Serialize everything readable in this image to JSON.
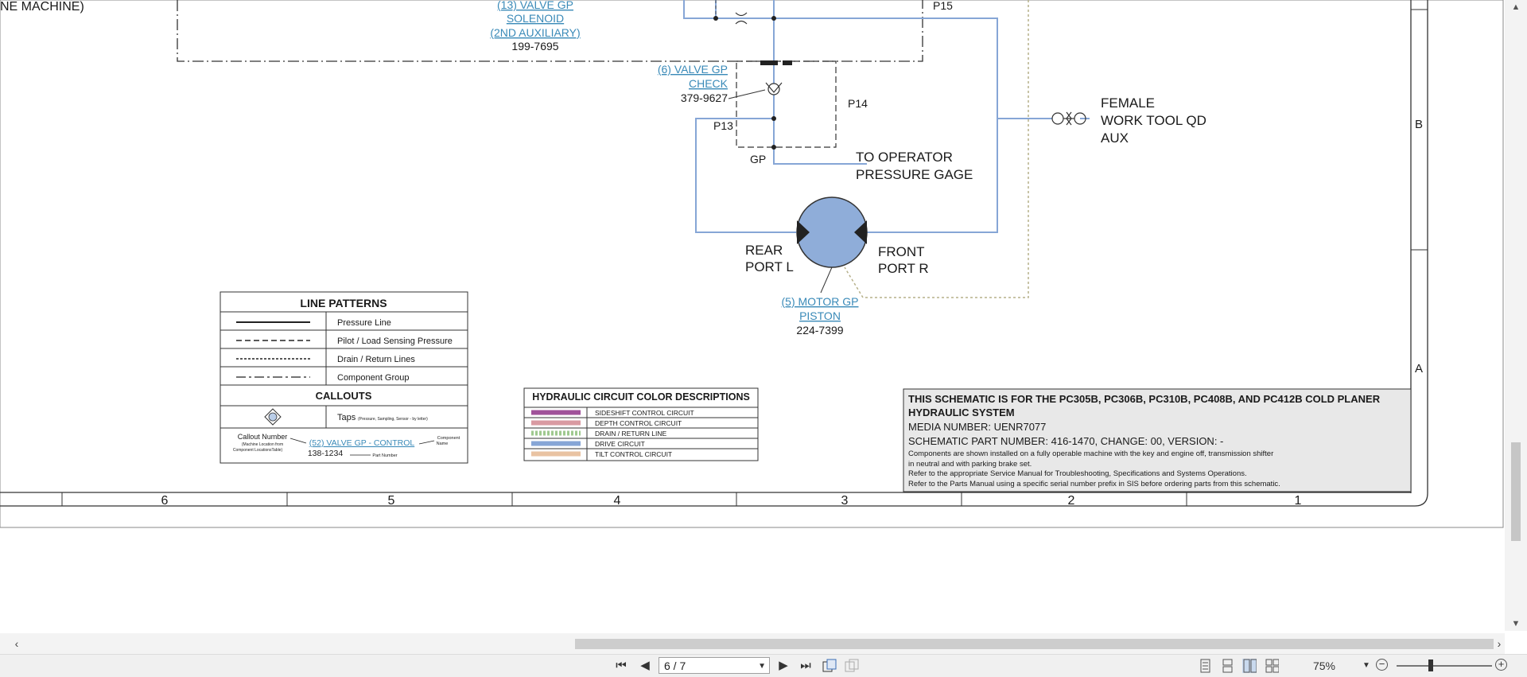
{
  "diagram": {
    "top_left_fragment": "NE MACHINE)",
    "valve13": {
      "line1": "(13) VALVE GP",
      "line2": "SOLENOID",
      "line3": "(2ND AUXILIARY)",
      "part": "199-7695"
    },
    "valve6": {
      "line1": "(6) VALVE GP",
      "line2": "CHECK",
      "part": "379-9627"
    },
    "motor5": {
      "line1": "(5) MOTOR GP",
      "line2": "PISTON",
      "part": "224-7399"
    },
    "labels": {
      "p15": "P15",
      "p14": "P14",
      "p13": "P13",
      "gp": "GP",
      "to_operator_1": "TO OPERATOR",
      "to_operator_2": "PRESSURE GAGE",
      "female_1": "FEMALE",
      "female_2": "WORK TOOL QD",
      "female_3": "AUX",
      "rear_1": "REAR",
      "rear_2": "PORT L",
      "front_1": "FRONT",
      "front_2": "PORT R"
    },
    "zones": {
      "b": "B",
      "a": "A"
    },
    "columns": [
      "6",
      "5",
      "4",
      "3",
      "2",
      "1"
    ],
    "line_patterns": {
      "title": "LINE PATTERNS",
      "rows": [
        "Pressure Line",
        "Pilot / Load Sensing Pressure",
        "Drain / Return Lines",
        "Component Group"
      ],
      "callouts_title": "CALLOUTS",
      "taps_label": "Taps",
      "taps_sub": "(Pressure, Sampling, Sensor - by letter)",
      "callout_number": "Callout Number",
      "callout_sub_1": "(Machine Location from",
      "callout_sub_2": "Component LocationsTable)",
      "callout_example": "(52) VALVE GP - CONTROL",
      "component_1": "Component",
      "component_2": "Name",
      "callout_part": "138-1234",
      "part_number": "Part Number"
    },
    "color_desc": {
      "title": "HYDRAULIC CIRCUIT COLOR DESCRIPTIONS",
      "rows": [
        {
          "label": "SIDESHIFT CONTROL CIRCUIT",
          "color": "#a0529a",
          "style": "solid"
        },
        {
          "label": "DEPTH CONTROL CIRCUIT",
          "color": "#d99aa2",
          "style": "solid"
        },
        {
          "label": "DRAIN / RETURN LINE",
          "color": "#9fc98f",
          "style": "dotted"
        },
        {
          "label": "DRIVE CIRCUIT",
          "color": "#86a6d6",
          "style": "solid"
        },
        {
          "label": "TILT CONTROL CIRCUIT",
          "color": "#e9c3a2",
          "style": "solid"
        }
      ]
    },
    "info": {
      "line1": "THIS SCHEMATIC IS FOR THE PC305B, PC306B, PC310B, PC408B, AND PC412B COLD PLANER",
      "line2": "HYDRAULIC SYSTEM",
      "line3": "MEDIA NUMBER: UENR7077",
      "line4": "SCHEMATIC PART NUMBER: 416-1470, CHANGE: 00, VERSION: -",
      "line5": "Components are shown installed on a fully operable machine with the key and engine off, transmission shifter",
      "line6": "in neutral and with parking brake set.",
      "line7": "Refer to the appropriate Service Manual for Troubleshooting, Specifications and Systems Operations.",
      "line8": "Refer to the Parts Manual using a specific serial number prefix in SIS before ordering parts from this schematic."
    },
    "colors": {
      "drive": "#86a6d6",
      "drain": "#b6b08a",
      "motor_fill": "#8fadd9",
      "link": "#3a8ab8"
    }
  },
  "toolbar": {
    "page_value": "6 / 7",
    "zoom": "75%"
  },
  "icons": {
    "first": "first-page-icon",
    "prev": "previous-page-icon",
    "next": "next-page-icon",
    "last": "last-page-icon",
    "zoom_out": "zoom-out-icon",
    "zoom_in": "zoom-in-icon"
  }
}
